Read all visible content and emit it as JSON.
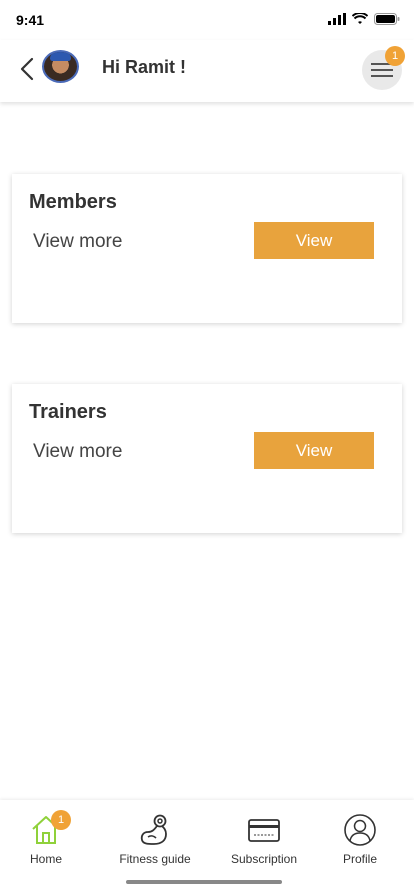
{
  "status": {
    "time": "9:41"
  },
  "header": {
    "greeting": "Hi Ramit !",
    "notification_count": "1"
  },
  "cards": [
    {
      "title": "Members",
      "subtitle": "View more",
      "button_label": "View"
    },
    {
      "title": "Trainers",
      "subtitle": "View more",
      "button_label": "View"
    }
  ],
  "nav": {
    "home_label": "Home",
    "home_badge": "1",
    "fitness_label": "Fitness guide",
    "subscription_label": "Subscription",
    "profile_label": "Profile"
  },
  "colors": {
    "accent": "#e8a33d",
    "badge": "#f0a236",
    "home_active": "#8fd13a"
  },
  "icons": [
    "back-chevron-icon",
    "hamburger-menu-icon",
    "home-icon",
    "fitness-arm-icon",
    "card-icon",
    "profile-icon"
  ]
}
